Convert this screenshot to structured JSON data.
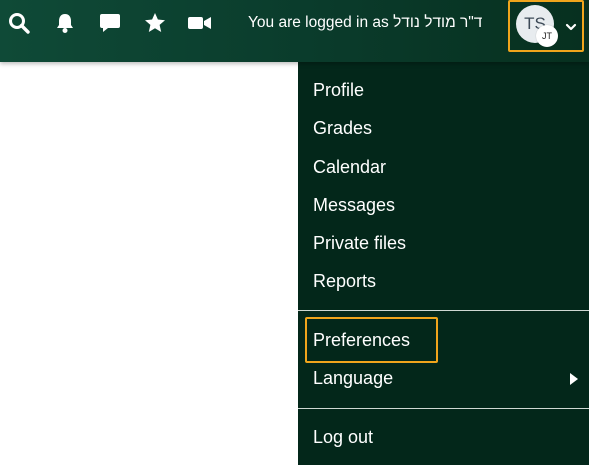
{
  "navbar": {
    "logged_in_text": "You are logged in as ד\"ר מודל נודל",
    "icons": [
      "search-icon",
      "bell-icon",
      "comment-icon",
      "star-icon",
      "video-icon"
    ],
    "user_avatar": {
      "initials": "TS",
      "badge_text": "JT"
    }
  },
  "user_menu": {
    "items": [
      "Profile",
      "Grades",
      "Calendar",
      "Messages",
      "Private files",
      "Reports"
    ],
    "preferences": "Preferences",
    "language": "Language",
    "logout": "Log out"
  },
  "colors": {
    "navbar": "#0a3b2b",
    "menu_background": "#03271a",
    "focus_outline": "#f0a51c"
  }
}
